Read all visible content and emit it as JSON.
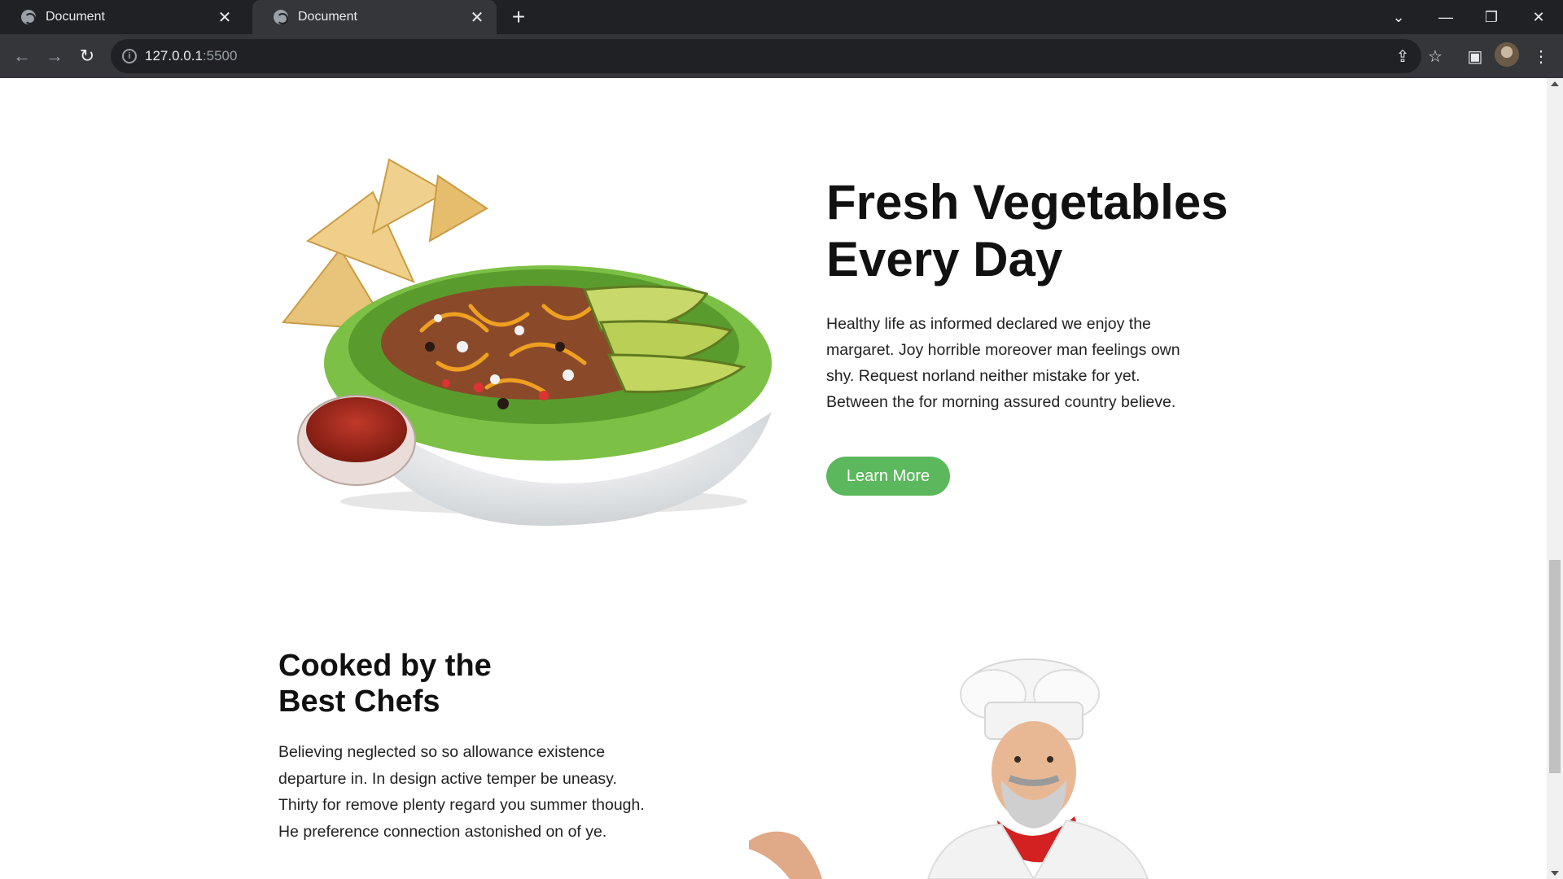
{
  "browser": {
    "tabs": [
      {
        "title": "Document",
        "active": false
      },
      {
        "title": "Document",
        "active": true
      }
    ],
    "url_host": "127.0.0.1",
    "url_port": ":5500"
  },
  "hero": {
    "title": "Fresh Vegetables\nEvery Day",
    "description": "Healthy life as informed declared we enjoy the margaret. Joy horrible moreover man feelings own shy. Request norland neither mistake for yet. Between the for morning assured country believe.",
    "button_label": "Learn More",
    "accent_color": "#5bb85c"
  },
  "chefs": {
    "title": "Cooked by the\nBest Chefs",
    "description": "Believing neglected so so allowance existence departure in. In design active temper be uneasy. Thirty for remove plenty regard you summer though. He preference connection astonished on of ye."
  },
  "icons": {
    "back": "arrow-left-icon",
    "forward": "arrow-right-icon",
    "reload": "reload-icon",
    "share": "share-icon",
    "bookmark": "star-icon",
    "sidepanel": "side-panel-icon",
    "menu": "kebab-menu-icon"
  }
}
